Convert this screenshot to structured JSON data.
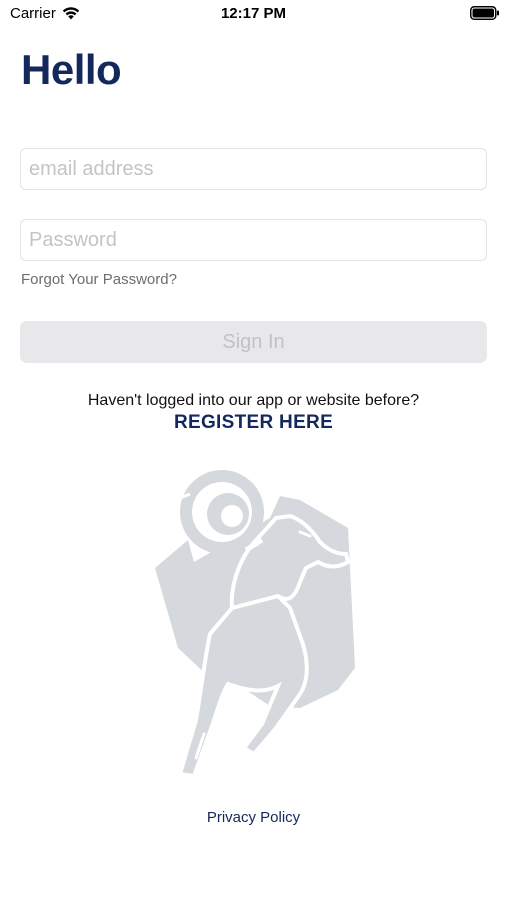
{
  "status_bar": {
    "carrier": "Carrier",
    "time": "12:17 PM",
    "wifi_icon": "wifi-icon",
    "battery_icon": "battery-icon"
  },
  "header": {
    "title": "Hello"
  },
  "form": {
    "email": {
      "value": "",
      "placeholder": "email address"
    },
    "password": {
      "value": "",
      "placeholder": "Password"
    },
    "forgot_label": "Forgot Your Password?",
    "signin_label": "Sign In"
  },
  "register": {
    "prompt": "Haven't logged into our app or website before?",
    "link_label": "REGISTER HERE"
  },
  "logo": {
    "icon": "ram-logo-icon"
  },
  "footer": {
    "privacy_label": "Privacy Policy"
  },
  "colors": {
    "brand_navy": "#14285c",
    "button_disabled_bg": "#e8e8ea",
    "button_disabled_text": "#c2c2c6",
    "logo_gray": "#d5d8dc"
  }
}
